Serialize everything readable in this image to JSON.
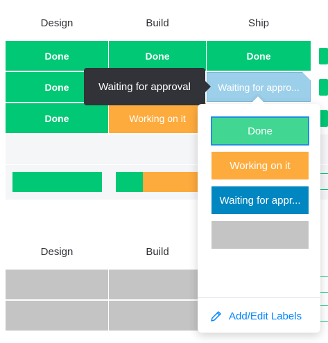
{
  "colors": {
    "done": "#00c875",
    "working": "#fdab3d",
    "waiting": "#9ccfea",
    "waiting_option": "#0086c0",
    "empty": "#c4c4c4",
    "tooltip_bg": "#323338",
    "link": "#0085ff",
    "selected_border": "#1f8fe0"
  },
  "group1": {
    "columns": [
      "Design",
      "Build",
      "Ship"
    ],
    "rows": [
      [
        "Done",
        "Done",
        "Done"
      ],
      [
        "Done",
        "",
        "Waiting for appro..."
      ],
      [
        "Done",
        "Working on it",
        ""
      ]
    ],
    "summary": {
      "design": {
        "done_fraction": 1.0
      },
      "build": {
        "done_fraction": 0.3,
        "working_fraction": 0.7
      }
    }
  },
  "group2": {
    "columns": [
      "Design",
      "Build"
    ],
    "rows": [
      [
        "",
        ""
      ],
      [
        "",
        ""
      ]
    ]
  },
  "tooltip": {
    "text": "Waiting for approval"
  },
  "dropdown": {
    "options": [
      {
        "label": "Done",
        "selected": true
      },
      {
        "label": "Working on it",
        "selected": false
      },
      {
        "label": "Waiting for appr...",
        "selected": false
      },
      {
        "label": "",
        "selected": false
      }
    ],
    "add_edit_label": "Add/Edit Labels",
    "add_edit_icon": "pencil-icon"
  }
}
